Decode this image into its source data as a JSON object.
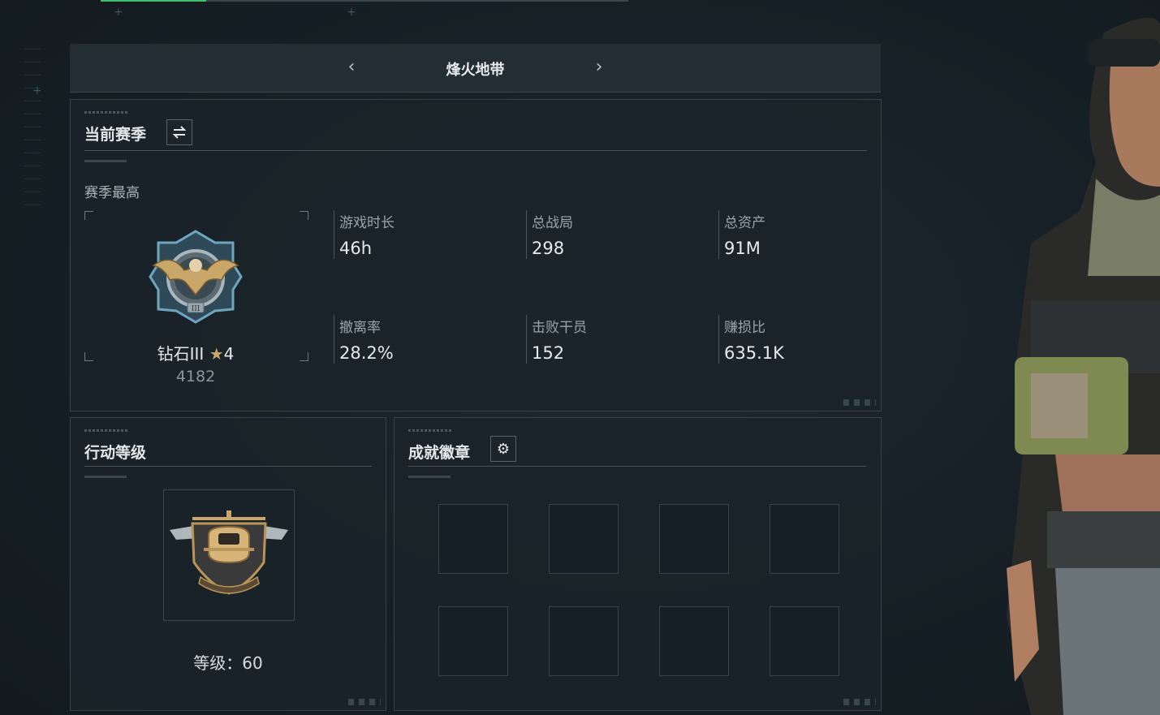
{
  "header": {
    "title": "烽火地带",
    "prev_arrow": "‹",
    "next_arrow": "›"
  },
  "season": {
    "title": "当前赛季",
    "switch_icon": "swap-arrows-icon",
    "best_label": "赛季最高",
    "rank_name": "钻石III",
    "rank_stars": "4",
    "rank_score": "4182",
    "stats": [
      {
        "label": "游戏时长",
        "value": "46h"
      },
      {
        "label": "总战局",
        "value": "298"
      },
      {
        "label": "总资产",
        "value": "91M"
      },
      {
        "label": "撤离率",
        "value": "28.2%"
      },
      {
        "label": "击败干员",
        "value": "152"
      },
      {
        "label": "赚损比",
        "value": "635.1K"
      }
    ]
  },
  "level": {
    "title": "行动等级",
    "label": "等级：60"
  },
  "badges": {
    "title": "成就徽章",
    "settings_icon": "gear-icon",
    "slots": 8
  },
  "colors": {
    "accent": "#3fbf6a",
    "gold": "#c9a66a"
  }
}
